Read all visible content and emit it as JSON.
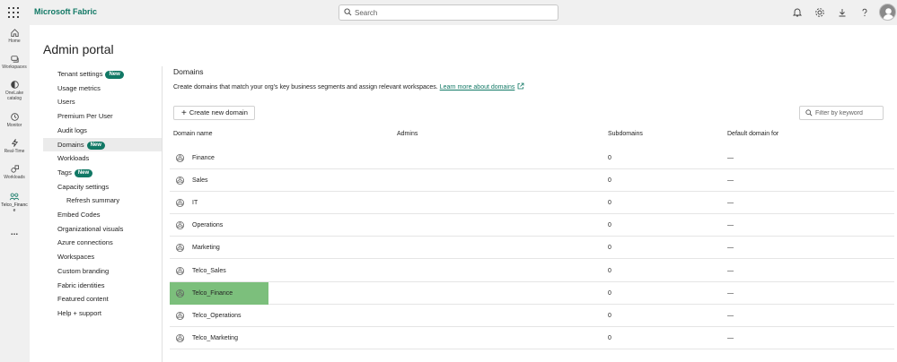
{
  "app": {
    "brand": "Microsoft Fabric"
  },
  "search": {
    "placeholder": "Search"
  },
  "topbar_icons": [
    "bell-icon",
    "gear-icon",
    "download-icon",
    "help-icon",
    "avatar"
  ],
  "rail": [
    {
      "label": "Home",
      "icon": "home-icon"
    },
    {
      "label": "Workspaces",
      "icon": "workspaces-icon"
    },
    {
      "label": "OneLake catalog",
      "icon": "onelake-icon"
    },
    {
      "label": "Monitor",
      "icon": "monitor-icon"
    },
    {
      "label": "Real-Time",
      "icon": "realtime-icon"
    },
    {
      "label": "Workloads",
      "icon": "workloads-icon"
    },
    {
      "label": "Telco_Financ e",
      "icon": "domain-icon"
    },
    {
      "label": "...",
      "icon": "more-icon"
    }
  ],
  "page": {
    "title": "Admin portal"
  },
  "nav": [
    {
      "label": "Tenant settings",
      "badge": "New"
    },
    {
      "label": "Usage metrics"
    },
    {
      "label": "Users"
    },
    {
      "label": "Premium Per User"
    },
    {
      "label": "Audit logs"
    },
    {
      "label": "Domains",
      "badge": "New"
    },
    {
      "label": "Workloads"
    },
    {
      "label": "Tags",
      "badge": "New"
    },
    {
      "label": "Capacity settings"
    },
    {
      "label": "Refresh summary"
    },
    {
      "label": "Embed Codes"
    },
    {
      "label": "Organizational visuals"
    },
    {
      "label": "Azure connections"
    },
    {
      "label": "Workspaces"
    },
    {
      "label": "Custom branding"
    },
    {
      "label": "Fabric identities"
    },
    {
      "label": "Featured content"
    },
    {
      "label": "Help + support"
    }
  ],
  "domains": {
    "title": "Domains",
    "description": "Create domains that match your org's key business segments and assign relevant workspaces.",
    "learn_more": "Learn more about domains",
    "new_button": "Create new domain",
    "filter_placeholder": "Filter by keyword",
    "columns": [
      "Domain name",
      "Admins",
      "Subdomains",
      "Default domain for"
    ],
    "rows": [
      {
        "name": "Finance",
        "admins": "",
        "subdomains": "0",
        "default_for": "—"
      },
      {
        "name": "Sales",
        "admins": "",
        "subdomains": "0",
        "default_for": "—"
      },
      {
        "name": "IT",
        "admins": "",
        "subdomains": "0",
        "default_for": "—"
      },
      {
        "name": "Operations",
        "admins": "",
        "subdomains": "0",
        "default_for": "—"
      },
      {
        "name": "Marketing",
        "admins": "",
        "subdomains": "0",
        "default_for": "—"
      },
      {
        "name": "Telco_Sales",
        "admins": "",
        "subdomains": "0",
        "default_for": "—"
      },
      {
        "name": "Telco_Finance",
        "admins": "",
        "subdomains": "0",
        "default_for": "—",
        "highlighted": true
      },
      {
        "name": "Telco_Operations",
        "admins": "",
        "subdomains": "0",
        "default_for": "—"
      },
      {
        "name": "Telco_Marketing",
        "admins": "",
        "subdomains": "0",
        "default_for": "—"
      }
    ]
  },
  "colors": {
    "brand": "#117865",
    "highlight": "#7cbf7c"
  }
}
